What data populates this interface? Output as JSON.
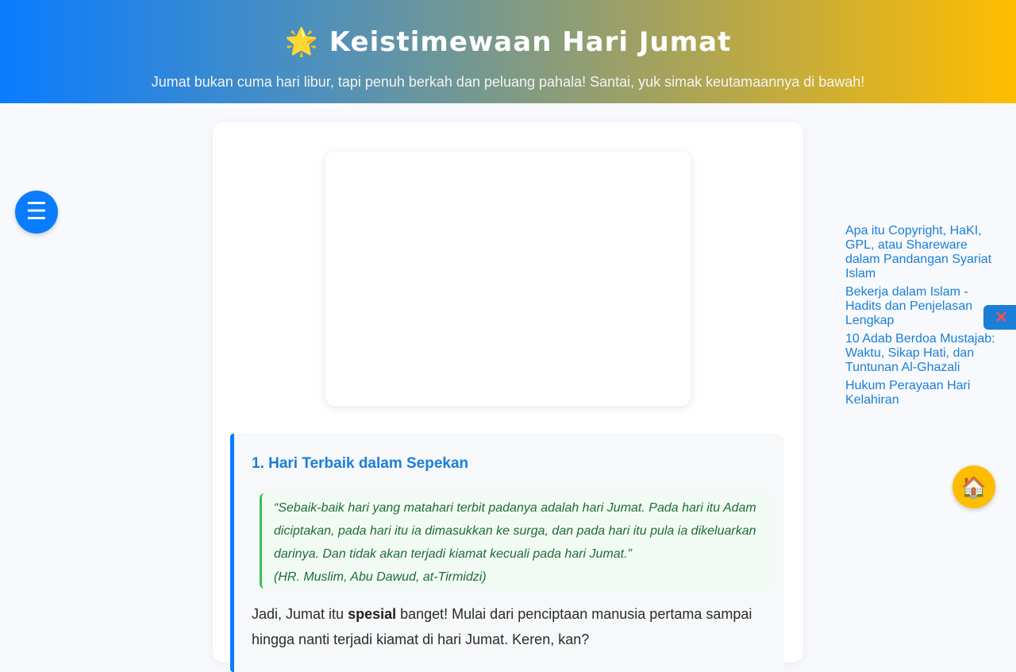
{
  "header": {
    "title_icon": "🌟",
    "title": "Keistimewaan Hari Jumat",
    "subtitle": "Jumat bukan cuma hari libur, tapi penuh berkah dan peluang pahala! Santai, yuk simak keutamaannya di bawah!"
  },
  "menu_button": {
    "icon": "☰",
    "icon_name": "menu-icon"
  },
  "section1": {
    "heading": "1. Hari Terbaik dalam Sepekan",
    "quote_lines": [
      "“Sebaik-baik hari yang matahari terbit padanya adalah hari Jumat. Pada hari itu Adam",
      "diciptakan, pada hari itu ia dimasukkan ke surga, dan pada hari itu pula ia dikeluarkan",
      "darinya. Dan tidak akan terjadi kiamat kecuali pada hari Jumat.”"
    ],
    "quote_source": "(HR. Muslim, Abu Dawud, at-Tirmidzi)",
    "para_before": "Jadi, Jumat itu ",
    "para_bold": "spesial",
    "para_after": " banget! Mulai dari penciptaan manusia pertama sampai",
    "para_line2": "hingga nanti terjadi kiamat di hari Jumat. Keren, kan?"
  },
  "related_links": [
    "Apa itu Copyright, HaKI, GPL, atau Shareware dalam Pandangan Syariat Islam",
    "Bekerja dalam Islam - Hadits dan Penjelasan Lengkap",
    "10 Adab Berdoa Mustajab: Waktu, Sikap Hati, dan Tuntunan Al-Ghazali",
    "Hukum Perayaan Hari Kelahiran"
  ],
  "close_button": {
    "icon": "✕",
    "icon_name": "close-icon"
  },
  "home_button": {
    "icon": "🏠",
    "icon_name": "home-icon"
  },
  "colors": {
    "accent_blue": "#0a7cff",
    "accent_yellow": "#ffbd00",
    "quote_green": "#3cbf55"
  }
}
